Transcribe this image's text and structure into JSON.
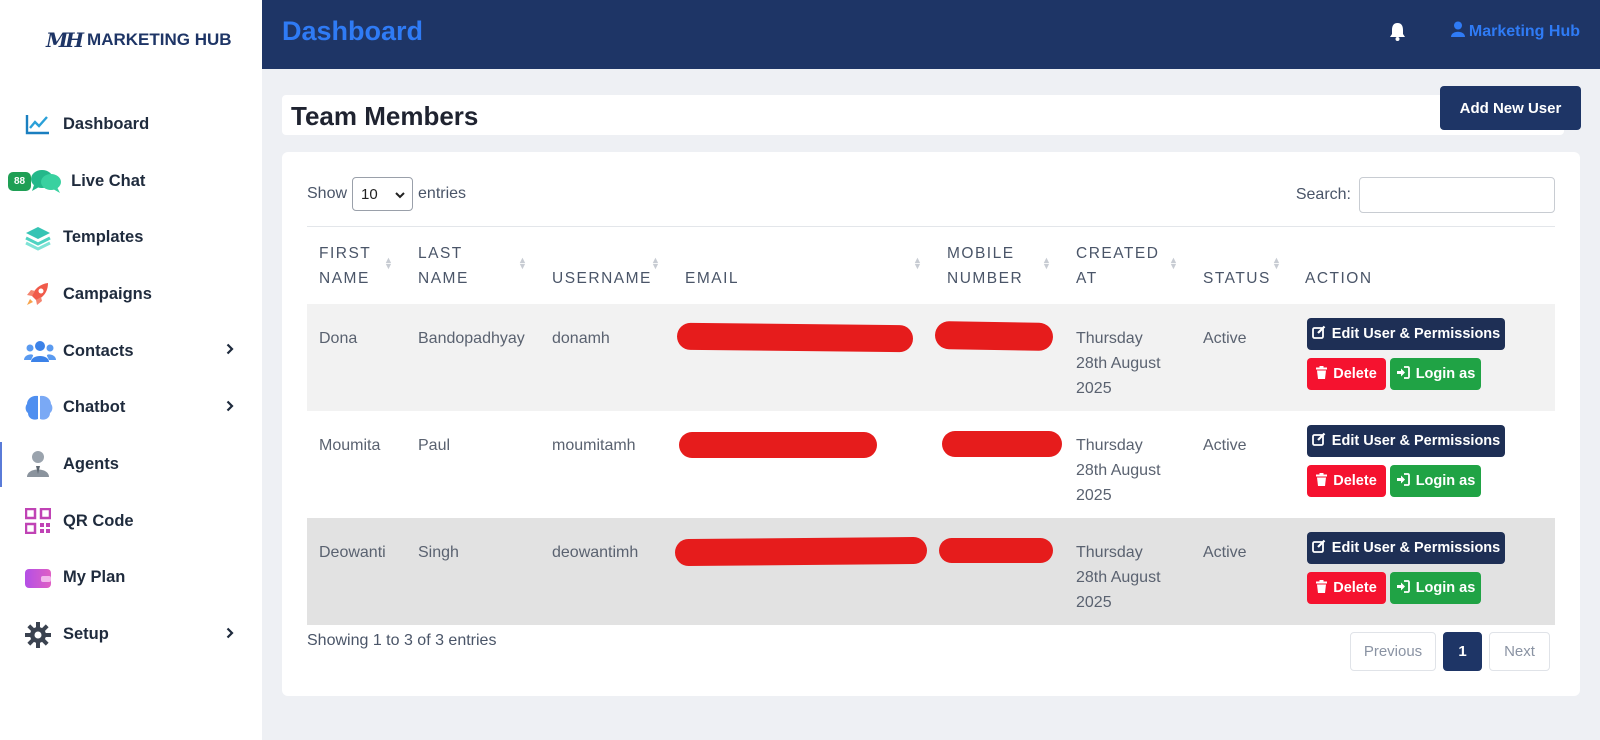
{
  "brand": {
    "mark": "MH",
    "name": "MARKETING HUB"
  },
  "sidebar": {
    "items": [
      {
        "label": "Dashboard",
        "icon": "chart-line-icon",
        "has_chevron": false
      },
      {
        "label": "Live Chat",
        "icon": "chat-bubbles-icon",
        "badge": "88",
        "has_chevron": false
      },
      {
        "label": "Templates",
        "icon": "layers-icon",
        "has_chevron": false
      },
      {
        "label": "Campaigns",
        "icon": "rocket-icon",
        "has_chevron": false
      },
      {
        "label": "Contacts",
        "icon": "users-icon",
        "has_chevron": true
      },
      {
        "label": "Chatbot",
        "icon": "brain-icon",
        "has_chevron": true
      },
      {
        "label": "Agents",
        "icon": "agent-icon",
        "has_chevron": false,
        "active": true
      },
      {
        "label": "QR Code",
        "icon": "qr-code-icon",
        "has_chevron": false
      },
      {
        "label": "My Plan",
        "icon": "wallet-icon",
        "has_chevron": false
      },
      {
        "label": "Setup",
        "icon": "gear-icon",
        "has_chevron": true
      }
    ]
  },
  "header": {
    "title": "Dashboard",
    "bell_icon": "bell-icon",
    "user_label": "Marketing Hub"
  },
  "page": {
    "title": "Team Members",
    "add_button": "Add New User"
  },
  "table_controls": {
    "show_label": "Show",
    "page_size": "10",
    "entries_label": "entries",
    "search_label": "Search:",
    "search_value": ""
  },
  "table": {
    "columns": [
      {
        "line1": "FIRST",
        "line2": "NAME"
      },
      {
        "line1": "LAST",
        "line2": "NAME"
      },
      {
        "line1": "",
        "line2": "USERNAME"
      },
      {
        "line1": "",
        "line2": "EMAIL"
      },
      {
        "line1": "MOBILE",
        "line2": "NUMBER"
      },
      {
        "line1": "CREATED",
        "line2": "AT"
      },
      {
        "line1": "",
        "line2": "STATUS"
      },
      {
        "line1": "",
        "line2": "ACTION"
      }
    ],
    "rows": [
      {
        "first": "Dona",
        "last": "Bandopadhyay",
        "username": "donamh",
        "created_l1": "Thursday",
        "created_l2": "28th August",
        "created_l3": "2025",
        "status": "Active"
      },
      {
        "first": "Moumita",
        "last": "Paul",
        "username": "moumitamh",
        "created_l1": "Thursday",
        "created_l2": "28th August",
        "created_l3": "2025",
        "status": "Active"
      },
      {
        "first": "Deowanti",
        "last": "Singh",
        "username": "deowantimh",
        "created_l1": "Thursday",
        "created_l2": "28th August",
        "created_l3": "2025",
        "status": "Active"
      }
    ],
    "actions": {
      "edit": "Edit User & Permissions",
      "delete": "Delete",
      "login": "Login as"
    }
  },
  "footer": {
    "info": "Showing 1 to 3 of 3 entries",
    "prev": "Previous",
    "page": "1",
    "next": "Next"
  },
  "colors": {
    "navy": "#1e3566",
    "accent_blue": "#2f7bf5",
    "delete_red": "#f5122f",
    "login_green": "#20a345",
    "redaction_red": "#e61c1c"
  }
}
